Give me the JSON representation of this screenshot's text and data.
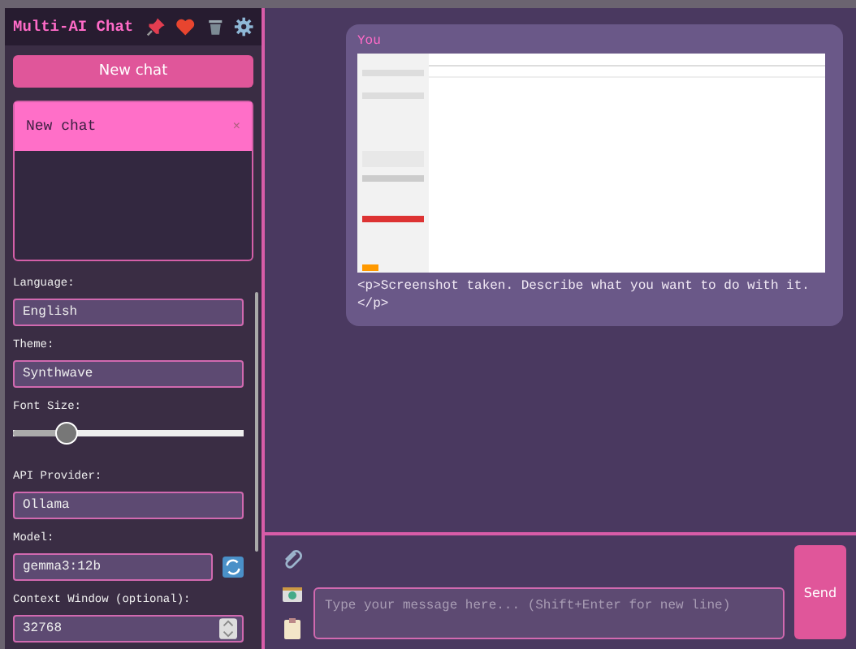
{
  "sidebar": {
    "title": "Multi-AI Chat",
    "new_chat": "New chat",
    "chats": [
      {
        "title": "New chat",
        "close": "×",
        "selected": true
      }
    ],
    "settings": [
      {
        "kind": "select",
        "label": "Language:",
        "value": "English"
      },
      {
        "kind": "select",
        "label": "Theme:",
        "value": "Synthwave"
      },
      {
        "kind": "slider",
        "label": "Font Size:",
        "level": 0.23
      },
      {
        "kind": "select",
        "label": "API Provider:",
        "value": "Ollama"
      },
      {
        "kind": "refresh",
        "label": "Model:",
        "value": "gemma3:12b"
      },
      {
        "kind": "number",
        "label": "Context Window (optional):",
        "value": "32768"
      }
    ]
  },
  "messages": [
    {
      "sender": "You",
      "kind": "screenshot",
      "text": "<p>Screenshot taken. Describe what you want to do with it.</p>"
    }
  ],
  "composer": {
    "placeholder": "Type your message here... (Shift+Enter for new line)",
    "send": "Send"
  }
}
